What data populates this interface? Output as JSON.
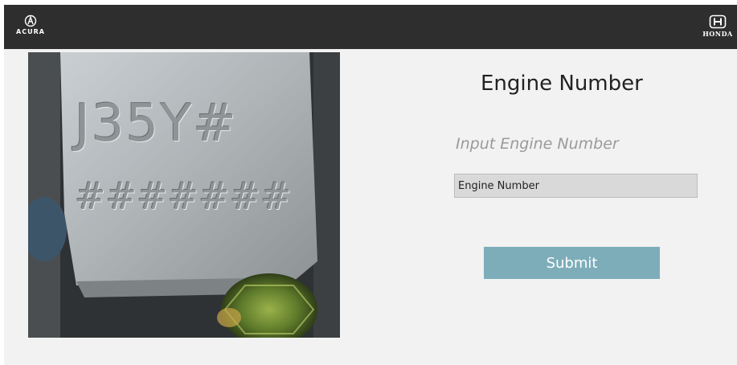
{
  "header": {
    "left_brand": {
      "name": "ACURA",
      "icon": "acura-logo-icon"
    },
    "right_brand": {
      "name": "HONDA",
      "icon": "honda-logo-icon"
    },
    "background": "#2e2e2e"
  },
  "photo": {
    "stamp_line1": "J35Y#",
    "stamp_line2": "#######"
  },
  "form": {
    "title": "Engine Number",
    "hint": "Input Engine Number",
    "input_placeholder": "Engine Number",
    "input_value": "",
    "submit_label": "Submit",
    "submit_color": "#7eadba"
  }
}
